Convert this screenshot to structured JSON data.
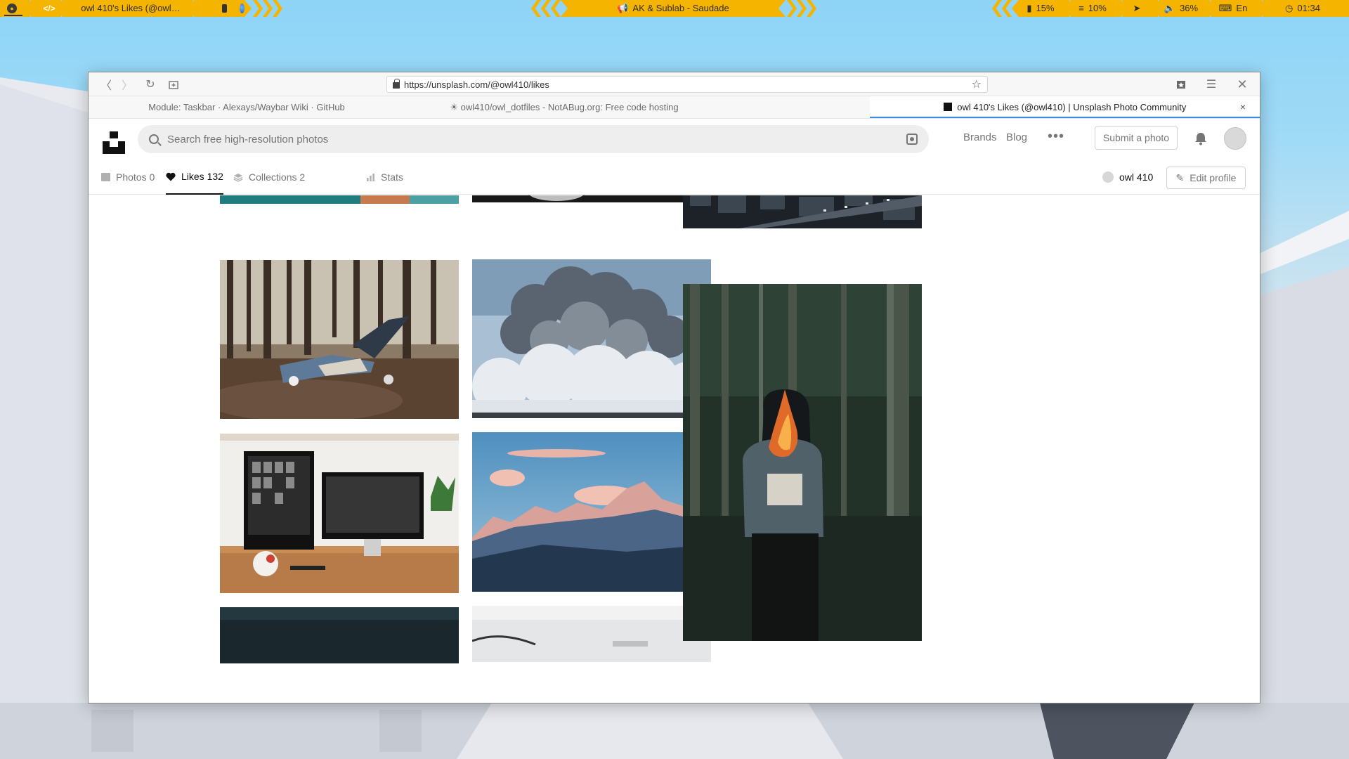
{
  "panel": {
    "left_window_title": "owl 410's Likes (@owl…",
    "code_icon": "</>",
    "media_title": "AK & Sublab - Saudade",
    "battery": "15%",
    "memory": "10%",
    "volume": "36%",
    "keyboard_layout": "En",
    "clock": "01:34",
    "accent_color": "#f5b400"
  },
  "browser": {
    "url": "https://unsplash.com/@owl410/likes",
    "tabs": [
      {
        "label": "Module: Taskbar · Alexays/Waybar Wiki · GitHub",
        "active": false
      },
      {
        "label": "owl410/owl_dotfiles - NotABug.org: Free code hosting",
        "active": false
      },
      {
        "label": "owl 410's Likes (@owl410) | Unsplash Photo Community",
        "active": true
      }
    ],
    "tab_close": "×"
  },
  "unsplash": {
    "search_placeholder": "Search free high-resolution photos",
    "nav": {
      "brands": "Brands",
      "blog": "Blog",
      "more": "•••"
    },
    "submit_label": "Submit a photo",
    "profile_tabs": {
      "photos": "Photos 0",
      "likes": "Likes 132",
      "collections": "Collections 2",
      "stats": "Stats"
    },
    "username": "owl 410",
    "edit_profile": "Edit profile"
  },
  "photos": [
    {
      "name": "photo-teal-top-cropped"
    },
    {
      "name": "photo-dark-top-cropped"
    },
    {
      "name": "photo-city-aerial"
    },
    {
      "name": "photo-forest-lying"
    },
    {
      "name": "photo-volcano-smoke"
    },
    {
      "name": "photo-burning-newspaper"
    },
    {
      "name": "photo-desk-monitors"
    },
    {
      "name": "photo-pink-mountains"
    },
    {
      "name": "photo-dark-bottom"
    },
    {
      "name": "photo-grey-bottom"
    }
  ]
}
